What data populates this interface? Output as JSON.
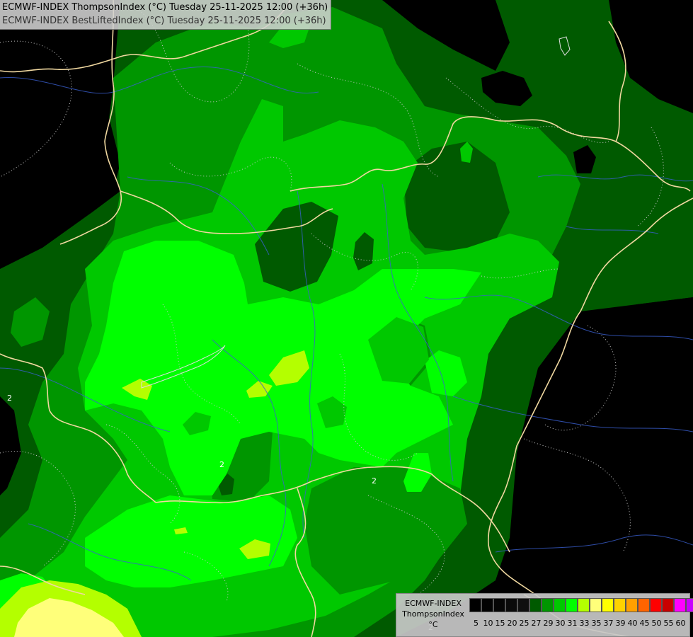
{
  "header": {
    "line1": "ECMWF-INDEX ThompsonIndex (°C) Tuesday 25-11-2025 12:00 (+36h)",
    "line2": "ECMWF-INDEX BestLiftedIndex (°C) Tuesday 25-11-2025 12:00 (+36h)"
  },
  "legend": {
    "model": "ECMWF-INDEX",
    "parameter": "ThompsonIndex",
    "unit": "°C",
    "colors": [
      "#000000",
      "#020202",
      "#050505",
      "#0a0a0a",
      "#0f0f0f",
      "#005a00",
      "#009600",
      "#00c800",
      "#00ff00",
      "#b4ff00",
      "#ffff7a",
      "#ffff00",
      "#ffd200",
      "#ffa000",
      "#ff6400",
      "#ff0000",
      "#c80000",
      "#ff00ff",
      "#c800ff",
      "#8c00ff",
      "#0000ff"
    ],
    "ticks": [
      "5",
      "10",
      "15",
      "20",
      "25",
      "27",
      "29",
      "30",
      "31",
      "33",
      "35",
      "37",
      "39",
      "40",
      "45",
      "50",
      "55",
      "60"
    ]
  },
  "map": {
    "contour_labels": [
      "2",
      "2",
      "2",
      "2"
    ],
    "palette": {
      "black": "#000000",
      "dark_green": "#005a00",
      "green": "#009600",
      "mid_green": "#00c800",
      "bright_green": "#00ff00",
      "yellow_green": "#b4ff00",
      "pale_yellow": "#ffff7a",
      "border": "#f0d8a0",
      "river": "#3a5fd0",
      "isoline": "#c8c8c8"
    }
  }
}
